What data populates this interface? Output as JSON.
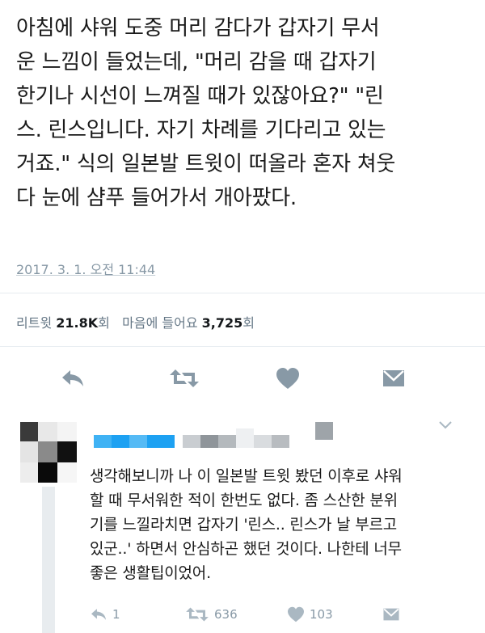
{
  "tweet": {
    "text_lines": [
      "아침에 샤워 도중 머리 감다가 갑자기 무서",
      "운 느낌이 들었는데, \"머리 감을 때 갑자기",
      "한기나 시선이 느껴질 때가 있잖아요?\" \"린",
      "스. 린스입니다. 자기 차례를 기다리고 있는",
      "거죠.\" 식의 일본발 트윗이 떠올라 혼자 쳐웃",
      "다 눈에 샴푸 들어가서 개아팠다."
    ],
    "timestamp": "2017. 3. 1. 오전 11:44"
  },
  "stats": {
    "retweet_label": "리트윗",
    "retweet_count": "21.8K",
    "retweet_unit": "회",
    "like_label": "마음에 들어요",
    "like_count": "3,725",
    "like_unit": "회"
  },
  "actions": {
    "reply_icon": "reply-icon",
    "retweet_icon": "retweet-icon",
    "like_icon": "heart-icon",
    "dm_icon": "envelope-icon",
    "icon_color": "#8899a6"
  },
  "reply": {
    "text_lines": [
      "생각해보니까 나 이 일본발 트윗 봤던 이후로 샤워",
      "할 때 무서워한 적이 한번도 없다. 좀 스산한 분위",
      "기를 느낄라치면 갑자기 '린스.. 린스가 날 부르고",
      "있군..' 하면서 안심하곤 했던 것이다. 나한테 너무",
      "좋은 생활팁이었어."
    ],
    "reply_count": "1",
    "retweet_count": "636",
    "like_count": "103"
  }
}
